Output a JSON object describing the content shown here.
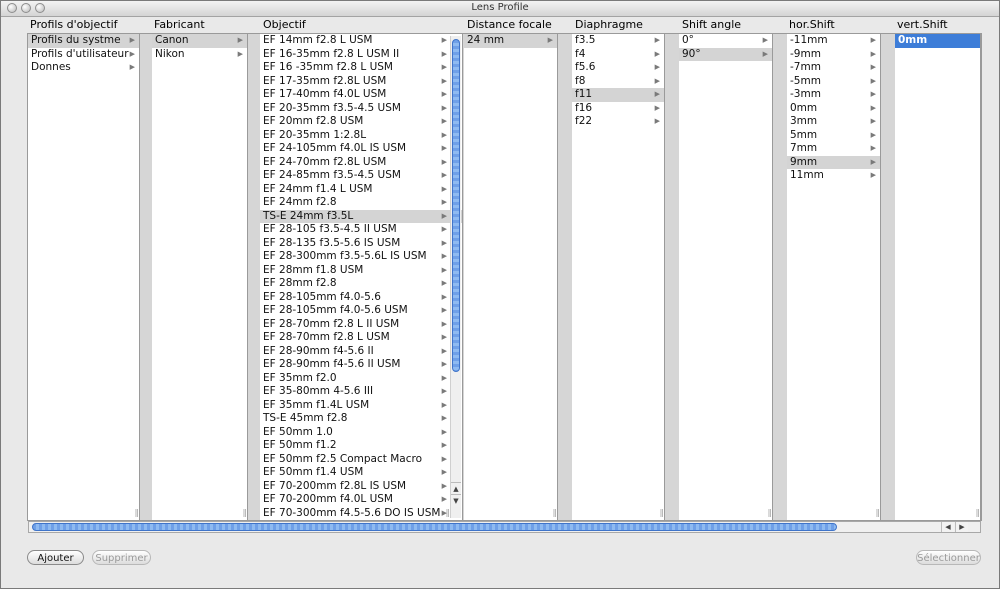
{
  "window": {
    "title": "Lens Profile"
  },
  "columns": [
    {
      "header": "Profils d'objectif",
      "items": [
        "Profils du systme",
        "Profils d'utilisateur",
        "Donnes"
      ],
      "selected": 0
    },
    {
      "header": "Fabricant",
      "items": [
        "Canon",
        "Nikon"
      ],
      "selected": 0
    },
    {
      "header": "Objectif",
      "items": [
        "EF 14mm f2.8 L USM",
        "EF 16-35mm f2.8 L USM II",
        "EF 16 -35mm f2.8 L USM",
        "EF 17-35mm f2.8L USM",
        "EF 17-40mm f4.0L USM",
        "EF 20-35mm f3.5-4.5 USM",
        "EF 20mm f2.8 USM",
        "EF 20-35mm 1:2.8L",
        "EF 24-105mm f4.0L IS USM",
        "EF 24-70mm f2.8L USM",
        "EF 24-85mm f3.5-4.5 USM",
        "EF 24mm f1.4 L USM",
        "EF 24mm f2.8",
        "TS-E 24mm f3.5L",
        "EF 28-105 f3.5-4.5 II USM",
        "EF 28-135 f3.5-5.6 IS USM",
        "EF 28-300mm f3.5-5.6L IS USM",
        "EF 28mm f1.8 USM",
        "EF 28mm f2.8",
        "EF 28-105mm f4.0-5.6",
        "EF 28-105mm f4.0-5.6 USM",
        "EF 28-70mm f2.8 L II USM",
        "EF 28-70mm f2.8 L USM",
        "EF 28-90mm f4-5.6 II",
        "EF 28-90mm f4-5.6 II USM",
        "EF 35mm f2.0",
        "EF 35-80mm 4-5.6 III",
        "EF 35mm f1.4L USM",
        "TS-E 45mm f2.8",
        "EF 50mm 1.0",
        "EF 50mm f1.2",
        "EF 50mm f2.5 Compact Macro",
        "EF 50mm f1.4 USM",
        "EF 70-200mm f2.8L IS USM",
        "EF 70-200mm f4.0L USM",
        "EF 70-300mm f4.5-5.6 DO IS USM"
      ],
      "selected": 13
    },
    {
      "header": "Distance focale",
      "items": [
        "24 mm"
      ],
      "selected": 0
    },
    {
      "header": "Diaphragme",
      "items": [
        "f3.5",
        "f4",
        "f5.6",
        "f8",
        "f11",
        "f16",
        "f22"
      ],
      "selected": 4
    },
    {
      "header": "Shift angle",
      "items": [
        "0°",
        "90°"
      ],
      "selected": 1
    },
    {
      "header": "hor.Shift",
      "items": [
        "-11mm",
        "-9mm",
        "-7mm",
        "-5mm",
        "-3mm",
        "0mm",
        "3mm",
        "5mm",
        "7mm",
        "9mm",
        "11mm"
      ],
      "selected": 9
    },
    {
      "header": "vert.Shift",
      "items": [
        "0mm"
      ],
      "selected": 0,
      "active": true
    }
  ],
  "buttons": {
    "add": "Ajouter",
    "remove": "Supprimer",
    "select": "Sélectionner"
  }
}
